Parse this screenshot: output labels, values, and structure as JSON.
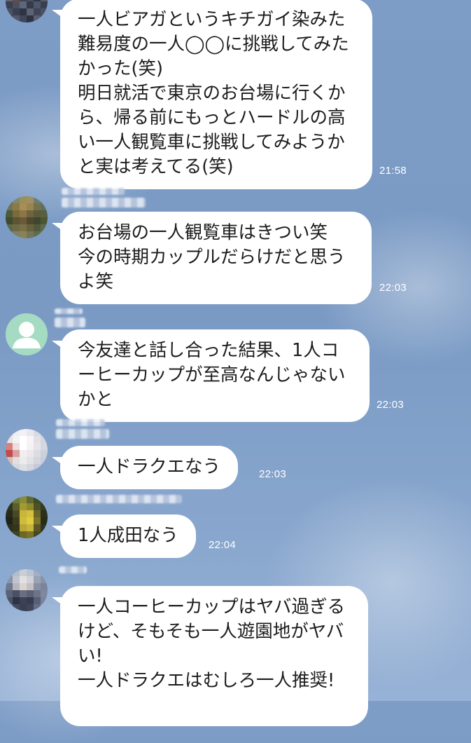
{
  "messages": [
    {
      "text": "一人ビアガというキチガイ染みた難易度の一人◯◯に挑戦してみたかった(笑)\n明日就活で東京のお台場に行くから、帰る前にもっとハードルの高い一人観覧車に挑戦してみようかと実は考えてる(笑)",
      "time": "21:58"
    },
    {
      "text": "お台場の一人観覧車はきつい笑\n今の時期カップルだらけだと思うよ笑",
      "time": "22:03"
    },
    {
      "text": "今友達と話し合った結果、1人コーヒーカップが至高なんじゃないかと",
      "time": "22:03"
    },
    {
      "text": "一人ドラクエなう",
      "time": "22:03"
    },
    {
      "text": "1人成田なう",
      "time": "22:04"
    },
    {
      "text": "一人コーヒーカップはヤバ過ぎるけど、そもそも一人遊園地がヤバい!\n一人ドラクエはむしろ一人推奨!",
      "time": ""
    }
  ],
  "avatars": [
    {
      "icon": "pixelated-photo-avatar"
    },
    {
      "icon": "pixelated-photo-avatar"
    },
    {
      "icon": "default-person-avatar"
    },
    {
      "icon": "pixelated-photo-avatar"
    },
    {
      "icon": "pixelated-photo-avatar"
    },
    {
      "icon": "pixelated-photo-avatar"
    }
  ],
  "colors": {
    "background": "#7d9cc6",
    "bubble": "#ffffff",
    "time_text": "#ffffff",
    "default_avatar": "#a8dcc4"
  }
}
